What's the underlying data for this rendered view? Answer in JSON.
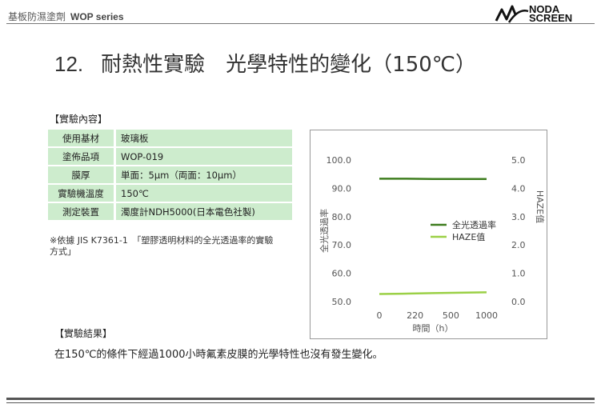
{
  "header": {
    "series_text": "基板防濕塗劑",
    "series_name": "WOP series",
    "logo_line1": "NODA",
    "logo_line2": "SCREEN"
  },
  "title": {
    "number": "12.",
    "text": "耐熱性實驗　光學特性的變化（150℃）"
  },
  "content_label": "【實驗內容】",
  "conditions": [
    {
      "key": "使用基材",
      "value": "玻璃板"
    },
    {
      "key": "塗佈品項",
      "value": "WOP-019"
    },
    {
      "key": "膜厚",
      "value": "単面：5μm（両面：10μm）"
    },
    {
      "key": "實驗機溫度",
      "value": "150℃"
    },
    {
      "key": "測定裝置",
      "value": "濁度計NDH5000(日本電色社製)"
    }
  ],
  "note": "※依據 JIS K7361-1　「塑膠透明材料的全光透過率的實驗方式」",
  "result_label": "【實驗結果】",
  "conclusion": "在150℃的條件下經過1000小時氟素皮膜的光學特性也沒有發生變化。",
  "colors": {
    "table_fill": "#cdeccd",
    "series_total": "#3e7d1e",
    "series_haze": "#9bd046"
  },
  "chart_data": {
    "type": "line",
    "x": [
      0,
      220,
      500,
      1000
    ],
    "xticks": [
      "0",
      "220",
      "500",
      "1000"
    ],
    "xlabel": "時間（h）",
    "ylabel": "全光透過率",
    "y2label": "HAZE值",
    "ylim": [
      50.0,
      100.0
    ],
    "y2lim": [
      0.0,
      5.0
    ],
    "yticks": [
      "50.0",
      "60.0",
      "70.0",
      "80.0",
      "90.0",
      "100.0"
    ],
    "y2ticks": [
      "0.0",
      "1.0",
      "2.0",
      "3.0",
      "4.0",
      "5.0"
    ],
    "series": [
      {
        "name": "全光透過率",
        "axis": "left",
        "values": [
          93.4,
          93.4,
          93.3,
          93.3
        ]
      },
      {
        "name": "HAZE值",
        "axis": "right",
        "values": [
          0.27,
          0.28,
          0.3,
          0.33
        ]
      }
    ],
    "legend": "right",
    "grid": false
  }
}
